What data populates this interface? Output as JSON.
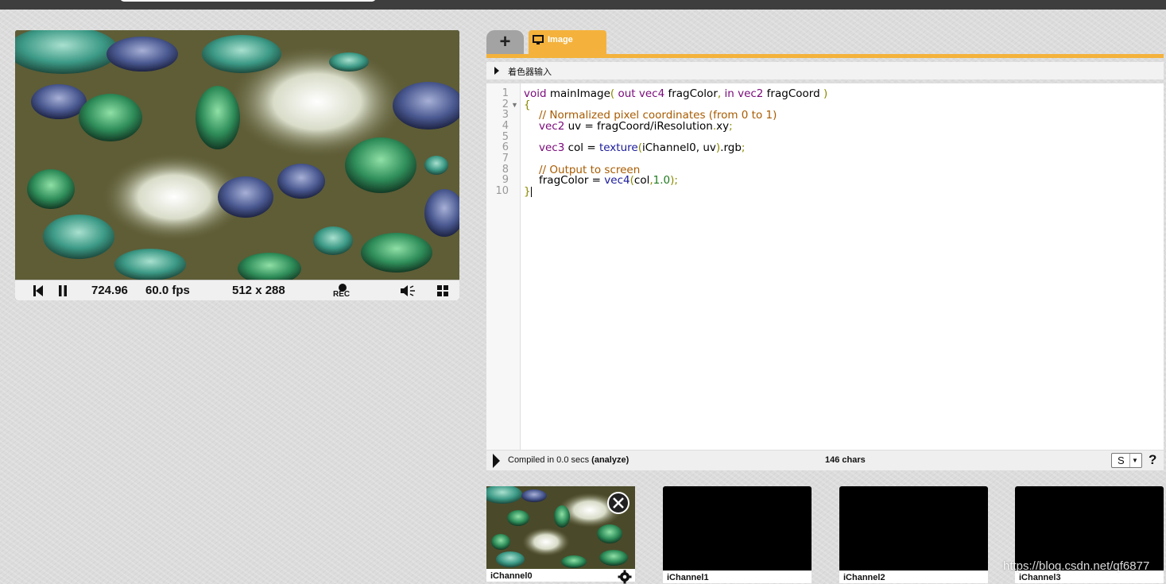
{
  "preview": {
    "time": "724.96",
    "fps": "60.0 fps",
    "resolution": "512 x 288",
    "rec_label": "REC",
    "icons": [
      "rewind-icon",
      "pause-icon",
      "record-icon",
      "volume-icon",
      "fullscreen-icon"
    ]
  },
  "tabs": {
    "add_label": "+",
    "image_label": "Image"
  },
  "inputs_row": {
    "label": "着色器输入"
  },
  "editor": {
    "line_numbers": [
      "1",
      "2",
      "3",
      "4",
      "5",
      "6",
      "7",
      "8",
      "9",
      "10"
    ],
    "lines": {
      "l1": [
        "void",
        " ",
        "mainImage",
        "(",
        " ",
        "out",
        " ",
        "vec4",
        " fragColor",
        ",",
        " ",
        "in",
        " ",
        "vec2",
        " fragCoord ",
        ")"
      ],
      "l2": "{",
      "l3": "// Normalized pixel coordinates (from 0 to 1)",
      "l4": [
        "vec2",
        " uv = fragCoord/iResolution",
        ".",
        "xy",
        ";"
      ],
      "l6": [
        "vec3",
        " col = ",
        "texture",
        "(",
        "iChannel0",
        ", ",
        "uv",
        ")",
        ".rgb",
        ";"
      ],
      "l8": "// Output to screen",
      "l9": [
        "fragColor = ",
        "vec4",
        "(",
        "col",
        ",",
        "1.0",
        ")",
        ";"
      ],
      "l10": "}"
    }
  },
  "status": {
    "compiled_prefix": "Compiled in 0.0 secs ",
    "analyze_label": "(analyze)",
    "chars": "146 chars",
    "select_value": "S",
    "help": "?"
  },
  "channels": [
    "iChannel0",
    "iChannel1",
    "iChannel2",
    "iChannel3"
  ],
  "watermark": "https://blog.csdn.net/qf6877",
  "colors": {
    "accent": "#f4b23c",
    "topbar": "#3e3e3e"
  }
}
